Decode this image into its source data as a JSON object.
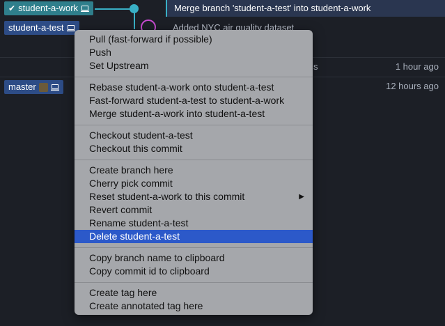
{
  "branches": {
    "work": "student-a-work",
    "test": "student-a-test",
    "master": "master"
  },
  "commits": [
    {
      "message": "Merge branch 'student-a-test' into student-a-work",
      "time": ""
    },
    {
      "message": "Added NYC air quality dataset",
      "time": ""
    },
    {
      "message": "s",
      "time": "1 hour ago"
    },
    {
      "message": "",
      "time": "12 hours ago"
    }
  ],
  "menu": {
    "groups": [
      [
        "Pull (fast-forward if possible)",
        "Push",
        "Set Upstream"
      ],
      [
        "Rebase student-a-work onto student-a-test",
        "Fast-forward student-a-test to student-a-work",
        "Merge student-a-work into student-a-test"
      ],
      [
        "Checkout student-a-test",
        "Checkout this commit"
      ],
      [
        "Create branch here",
        "Cherry pick commit",
        "Reset student-a-work to this commit",
        "Revert commit",
        "Rename student-a-test",
        "Delete student-a-test"
      ],
      [
        "Copy branch name to clipboard",
        "Copy commit id to clipboard"
      ],
      [
        "Create tag here",
        "Create annotated tag here"
      ]
    ],
    "active_item": "Delete student-a-test",
    "submenu_item": "Reset student-a-work to this commit",
    "submenu_arrow": "▶"
  },
  "icons": {
    "check": "✔",
    "computer": "computer-icon"
  },
  "colors": {
    "accent": "#39b0c6",
    "menu_highlight": "#2c59c9",
    "branch_local": "#2d4c86",
    "branch_checked": "#2f7f8c"
  }
}
